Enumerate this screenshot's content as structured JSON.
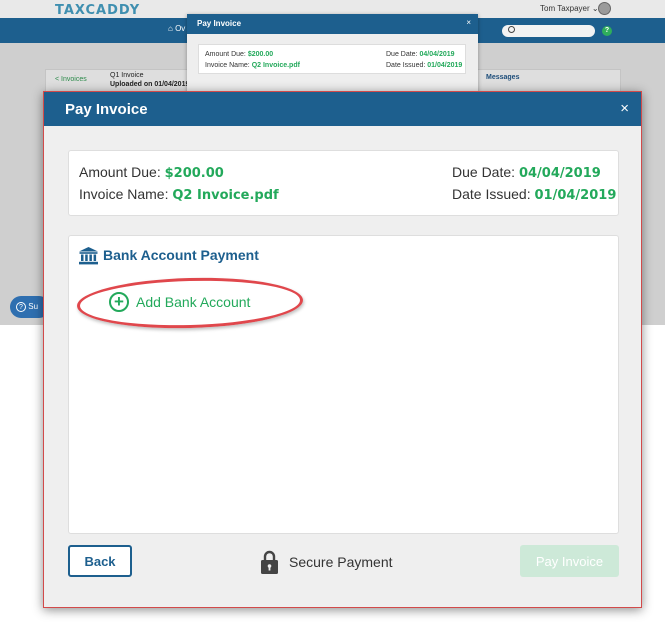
{
  "background": {
    "logo": "TAXCADDY",
    "user_name": "Tom Taxpayer",
    "nav_home": "Ov",
    "invoices_link": "< Invoices",
    "current_title": "Q1 Invoice",
    "current_subtitle": "Uploaded on 01/04/2019",
    "messages_tab": "Messages",
    "support_label": "Su",
    "help_glyph": "?"
  },
  "background_modal": {
    "title": "Pay Invoice",
    "close": "×",
    "amount_due_label": "Amount Due:",
    "amount_due_value": "$200.00",
    "invoice_name_label": "Invoice Name:",
    "invoice_name_value": "Q2 Invoice.pdf",
    "due_date_label": "Due Date:",
    "due_date_value": "04/04/2019",
    "date_issued_label": "Date Issued:",
    "date_issued_value": "01/04/2019"
  },
  "modal": {
    "title": "Pay Invoice",
    "close": "×",
    "amount_due_label": "Amount Due:",
    "amount_due_value": "$200.00",
    "invoice_name_label": "Invoice Name:",
    "invoice_name_value": "Q2 Invoice.pdf",
    "due_date_label": "Due Date:",
    "due_date_value": "04/04/2019",
    "date_issued_label": "Date Issued:",
    "date_issued_value": "01/04/2019",
    "section_title": "Bank Account Payment",
    "add_bank_label": "Add Bank Account",
    "back_label": "Back",
    "secure_label": "Secure Payment",
    "pay_label": "Pay Invoice"
  },
  "icons": {
    "bank": "bank-icon",
    "add": "plus-circle-icon",
    "lock": "lock-icon",
    "search": "search-icon"
  },
  "colors": {
    "brand_blue": "#1d5f8e",
    "accent_green": "#23a95b",
    "highlight_red": "#e0474c",
    "disabled_green": "#cde9d8"
  }
}
